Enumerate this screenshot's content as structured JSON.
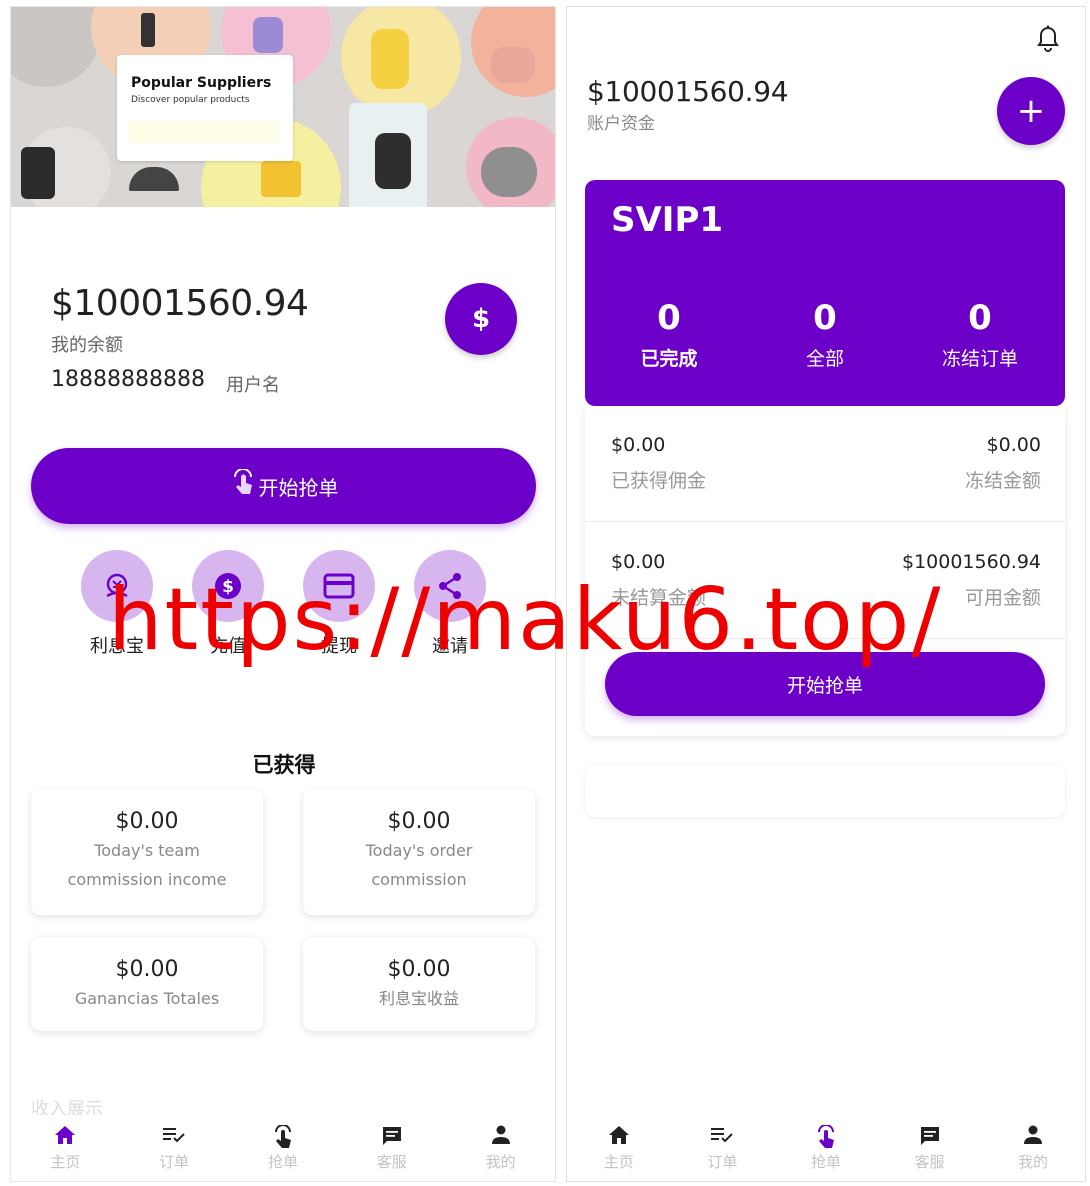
{
  "left": {
    "banner": {
      "title": "Popular Suppliers",
      "subtitle": "Discover popular products"
    },
    "balance": {
      "amount": "$10001560.94",
      "label": "我的余额"
    },
    "user": {
      "phone": "18888888888",
      "label": "用户名"
    },
    "dollar_button": "$",
    "grab_button": {
      "label": "开始抢单",
      "icon": "tap-hand-icon"
    },
    "quick_actions": [
      {
        "label": "利息宝",
        "icon": "interest-coin-icon"
      },
      {
        "label": "充值",
        "icon": "dollar-coin-icon"
      },
      {
        "label": "提现",
        "icon": "credit-card-icon"
      },
      {
        "label": "邀请",
        "icon": "share-icon"
      }
    ],
    "earned_title": "已获得",
    "stats": [
      {
        "amount": "$0.00",
        "desc": "Today's team commission income"
      },
      {
        "amount": "$0.00",
        "desc": "Today's order commission"
      },
      {
        "amount": "$0.00",
        "desc": "Ganancias Totales"
      },
      {
        "amount": "$0.00",
        "desc": "利息宝收益"
      }
    ],
    "partial_section": "收入展示"
  },
  "right": {
    "balance": {
      "amount": "$10001560.94",
      "label": "账户资金"
    },
    "plus_button": "+",
    "vip": {
      "level": "SVIP1",
      "stats": [
        {
          "value": "0",
          "label": "已完成"
        },
        {
          "value": "0",
          "label": "全部"
        },
        {
          "value": "0",
          "label": "冻结订单"
        }
      ]
    },
    "info_rows": [
      {
        "left_amount": "$0.00",
        "left_label": "已获得佣金",
        "right_amount": "$0.00",
        "right_label": "冻结金额"
      },
      {
        "left_amount": "$0.00",
        "left_label": "未结算金额",
        "right_amount": "$10001560.94",
        "right_label": "可用金额"
      }
    ],
    "grab_button": "开始抢单"
  },
  "tabbar": [
    {
      "label": "主页",
      "icon": "home-icon"
    },
    {
      "label": "订单",
      "icon": "order-list-icon"
    },
    {
      "label": "抢单",
      "icon": "tap-hand-icon"
    },
    {
      "label": "客服",
      "icon": "chat-icon"
    },
    {
      "label": "我的",
      "icon": "person-icon"
    }
  ],
  "watermark": "https://maku6.top/",
  "colors": {
    "primary": "#6c00c8",
    "light_purple": "#d7b6f0",
    "watermark": "#ee0000"
  }
}
